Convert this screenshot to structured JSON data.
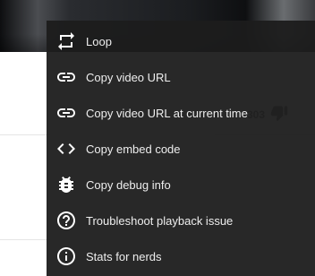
{
  "background": {
    "like_count_partial": "303"
  },
  "context_menu": {
    "items": [
      {
        "label": "Loop",
        "icon": "loop-icon"
      },
      {
        "label": "Copy video URL",
        "icon": "link-icon"
      },
      {
        "label": "Copy video URL at current time",
        "icon": "link-icon"
      },
      {
        "label": "Copy embed code",
        "icon": "code-icon"
      },
      {
        "label": "Copy debug info",
        "icon": "bug-icon"
      },
      {
        "label": "Troubleshoot playback issue",
        "icon": "help-circle-icon"
      },
      {
        "label": "Stats for nerds",
        "icon": "info-circle-icon"
      }
    ]
  }
}
